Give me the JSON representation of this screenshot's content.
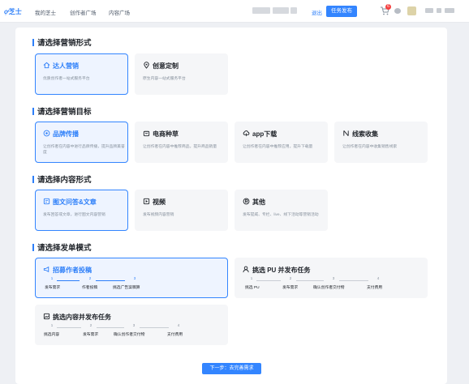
{
  "topbar": {
    "logo": "芝士",
    "nav": [
      "我的芝士",
      "创作者广场",
      "内容广场"
    ],
    "logout": "退出",
    "publish": "任务发布",
    "cart_badge": "6"
  },
  "sections": {
    "marketing_form": {
      "title": "请选择营销形式",
      "cards": [
        {
          "title": "达人营销",
          "desc": "优质创作者一站式服务平台",
          "selected": true,
          "icon": "home-icon"
        },
        {
          "title": "创意定制",
          "desc": "原生内容一站式服务平台",
          "selected": false,
          "icon": "location-pin-icon"
        }
      ]
    },
    "marketing_goal": {
      "title": "请选择营销目标",
      "cards": [
        {
          "title": "品牌传播",
          "desc": "让创作者在内容中进行品牌传播，提升品牌美誉度",
          "selected": true,
          "icon": "target-icon"
        },
        {
          "title": "电商种草",
          "desc": "让创作者在内容中推荐商品，提升商品销量",
          "selected": false,
          "icon": "shop-icon"
        },
        {
          "title": "app下载",
          "desc": "让创作者在内容中推荐应用，提升下载量",
          "selected": false,
          "icon": "cloud-icon"
        },
        {
          "title": "线索收集",
          "desc": "让创作者在内容中收集销售线索",
          "selected": false,
          "icon": "funnel-icon"
        }
      ]
    },
    "content_form": {
      "title": "请选择内容形式",
      "cards": [
        {
          "title": "图文问答&文章",
          "desc": "发布回答或文章，进行图文内容营销",
          "selected": true,
          "icon": "article-icon"
        },
        {
          "title": "视频",
          "desc": "发布视频内容营销",
          "selected": false,
          "icon": "video-icon"
        },
        {
          "title": "其他",
          "desc": "发布提威、专栏、live、线下活动等营销活动",
          "selected": false,
          "icon": "other-icon"
        }
      ]
    },
    "order_mode": {
      "title": "请选择发单模式",
      "cards": [
        {
          "title": "招募作者投稿",
          "selected": true,
          "icon": "megaphone-icon",
          "steps": [
            {
              "num": "1",
              "label": "发布需求"
            },
            {
              "num": "2",
              "label": "作者投稿"
            },
            {
              "num": "3",
              "label": "挑选广告案稿算"
            }
          ]
        },
        {
          "title": "挑选 PU 并发布任务",
          "selected": false,
          "icon": "person-icon",
          "steps": [
            {
              "num": "1",
              "label": "挑选 PU"
            },
            {
              "num": "2",
              "label": "发布需求"
            },
            {
              "num": "3",
              "label": "确认创作者交付物"
            },
            {
              "num": "4",
              "label": "支付费用"
            }
          ]
        },
        {
          "title": "挑选内容并发布任务",
          "selected": false,
          "icon": "content-icon",
          "steps": [
            {
              "num": "1",
              "label": "挑选内容"
            },
            {
              "num": "2",
              "label": "发布需求"
            },
            {
              "num": "3",
              "label": "确认创作者交付物"
            },
            {
              "num": "4",
              "label": "支付费用"
            }
          ]
        }
      ]
    }
  },
  "next_button": "下一步：去完善需求",
  "colors": {
    "accent": "#3385ff",
    "selected_bg": "#eef4ff",
    "card_bg": "#f5f6f8",
    "badge": "#f53f3f"
  }
}
